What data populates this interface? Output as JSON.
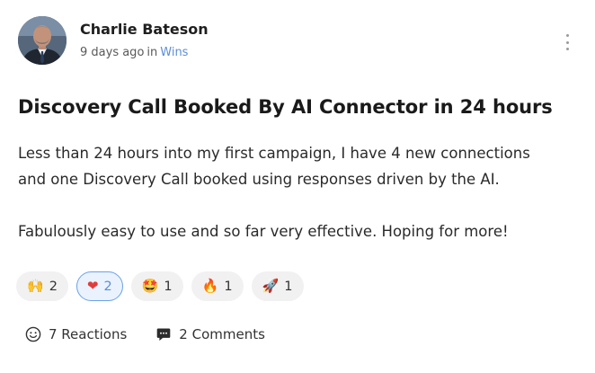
{
  "author": {
    "name": "Charlie Bateson"
  },
  "meta": {
    "time": "9 days ago",
    "in_word": "in",
    "category": "Wins"
  },
  "post": {
    "title": "Discovery Call Booked By AI Connector in 24 hours",
    "body_lines": [
      "Less than 24 hours into my first campaign, I have 4 new connections",
      "and one Discovery Call booked using responses driven by the AI.",
      "Fabulously easy to use and so far very effective. Hoping for more!"
    ]
  },
  "reactions": [
    {
      "icon": "raised-hands-icon",
      "glyph": "🙌",
      "count": "2",
      "active": false
    },
    {
      "icon": "heart-icon",
      "glyph": "❤",
      "count": "2",
      "active": true
    },
    {
      "icon": "star-struck-face-icon",
      "glyph": "🤩",
      "count": "1",
      "active": false
    },
    {
      "icon": "fire-icon",
      "glyph": "🔥",
      "count": "1",
      "active": false
    },
    {
      "icon": "rocket-icon",
      "glyph": "🚀",
      "count": "1",
      "active": false
    }
  ],
  "footer": {
    "reactions_label": "7 Reactions",
    "comments_label": "2 Comments"
  },
  "colors": {
    "accent": "#5b8fd6",
    "active_border": "#6aa2e6",
    "pill_bg": "#f1f1f1"
  }
}
